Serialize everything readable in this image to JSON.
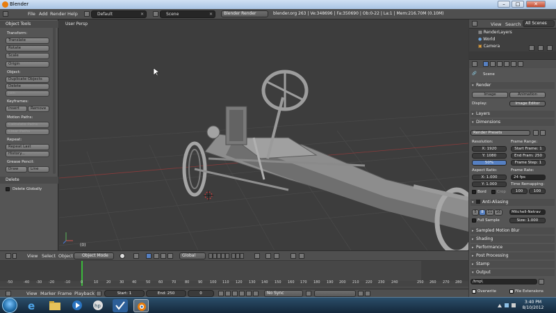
{
  "window": {
    "title": "Blender",
    "minimize": "–",
    "maximize": "□",
    "close": "✕"
  },
  "info_header": {
    "menus": [
      "File",
      "Add",
      "Render",
      "Help"
    ],
    "screen_layout": "Default",
    "scene": "Scene",
    "render_engine": "Blender Render",
    "stats": "blender.org 263 | Ve:348696 | Fa:350690 | Ob:0-22 | La:1 | Mem:216.70M (0.10M)"
  },
  "tool_shelf": {
    "title": "Object Tools",
    "transform_label": "Transform:",
    "translate": "Translate",
    "rotate": "Rotate",
    "scale": "Scale",
    "origin": "Origin",
    "object_label": "Object:",
    "duplicate_objects": "Duplicate Objects",
    "delete": "Delete",
    "join": "Join",
    "keyframes_label": "Keyframes:",
    "insert": "Insert",
    "remove": "Remove",
    "motion_paths_label": "Motion Paths:",
    "calculate_paths": "Calculate Paths",
    "clear_paths": "Clear Paths",
    "repeat_label": "Repeat:",
    "repeat_last": "Repeat Last",
    "history": "History...",
    "grease_pencil_label": "Grease Pencil:",
    "draw": "Draw",
    "line": "Line",
    "delete_panel": "Delete",
    "delete_globally": "Delete Globally"
  },
  "viewport": {
    "label": "User Persp",
    "frame": "(0)"
  },
  "view3d_header": {
    "menus": [
      "View",
      "Select",
      "Object"
    ],
    "mode": "Object Mode",
    "orientation": "Global"
  },
  "timeline": {
    "ticks": [
      "-50",
      "-40",
      "-30",
      "-20",
      "-10",
      "0",
      "10",
      "20",
      "30",
      "40",
      "50",
      "60",
      "70",
      "80",
      "90",
      "100",
      "110",
      "120",
      "130",
      "140",
      "150",
      "160",
      "170",
      "180",
      "190",
      "200",
      "210",
      "220",
      "230",
      "240",
      "250",
      "260",
      "270",
      "280"
    ],
    "menus": [
      "View",
      "Marker",
      "Frame",
      "Playback"
    ],
    "start": "Start: 1",
    "end": "End: 250",
    "current": "0",
    "sync": "No Sync"
  },
  "outliner": {
    "menus": [
      "View",
      "Search"
    ],
    "filter": "All Scenes",
    "rows": [
      "RenderLayers",
      "World",
      "Camera"
    ]
  },
  "properties": {
    "context": "Scene",
    "render_section": "Render",
    "image_button": "Image",
    "animation_button": "Animation",
    "display_label": "Display:",
    "display_value": "Image Editor",
    "layers_section": "Layers",
    "dimensions_section": "Dimensions",
    "presets": "Render Presets",
    "resolution_label": "Resolution:",
    "res_x": "X: 1920",
    "res_y": "Y: 1080",
    "res_pct": "50%",
    "frame_range_label": "Frame Range:",
    "start_frame": "Start Frame: 1",
    "end_frame": "End Fram: 250",
    "frame_step": "Frame Step: 1",
    "aspect_label": "Aspect Ratio:",
    "aspect_x": "X: 1.000",
    "aspect_y": "Y: 1.000",
    "frame_rate_label": "Frame Rate:",
    "frame_rate": "24 fps",
    "time_remap_label": "Time Remapping:",
    "remap_old": "100",
    "remap_new": "100",
    "bord": "Bord",
    "crop": "Crop",
    "aa_section": "Anti-Aliasing",
    "aa_samples": [
      "5",
      "8",
      "11",
      "16"
    ],
    "aa_filter": "Mitchell-Netrav",
    "full_sample": "Full Sample",
    "aa_size": "Size: 1.000",
    "motion_blur": "Sampled Motion Blur",
    "shading": "Shading",
    "performance": "Performance",
    "post_processing": "Post Processing",
    "stamp": "Stamp",
    "output": "Output",
    "output_path": "/tmp\\",
    "overwrite": "Overwrite",
    "file_extensions": "File Extensions"
  },
  "taskbar": {
    "time": "3:40 PM",
    "date": "8/10/2012"
  },
  "colors": {
    "accent_blue": "#5680c2",
    "frame_green": "#3cb93c",
    "blender_orange": "#e87d0d"
  }
}
